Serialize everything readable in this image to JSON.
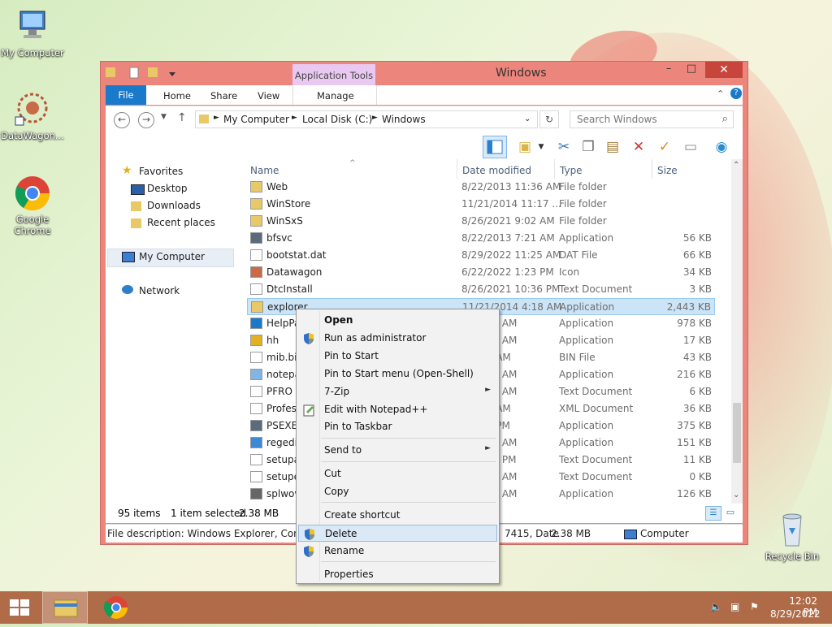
{
  "desktop": {
    "icons": [
      {
        "label": "My Computer"
      },
      {
        "label": "DataWagon..."
      },
      {
        "label": "Google Chrome"
      },
      {
        "label": "Recycle Bin"
      }
    ]
  },
  "window": {
    "title": "Windows",
    "ribbon_tabs": {
      "file": "File",
      "home": "Home",
      "share": "Share",
      "view": "View",
      "context_group": "Application Tools",
      "manage": "Manage"
    },
    "breadcrumb": [
      "My Computer",
      "Local Disk (C:)",
      "Windows"
    ],
    "search_placeholder": "Search Windows",
    "nav": {
      "favorites": "Favorites",
      "desktop": "Desktop",
      "downloads": "Downloads",
      "recent": "Recent places",
      "my_computer": "My Computer",
      "network": "Network"
    },
    "columns": {
      "name": "Name",
      "date": "Date modified",
      "type": "Type",
      "size": "Size"
    },
    "files": [
      {
        "name": "Web",
        "date": "8/22/2013 11:36 AM",
        "type": "File folder",
        "size": "",
        "icon": "folder-icon"
      },
      {
        "name": "WinStore",
        "date": "11/21/2014 11:17 ...",
        "type": "File folder",
        "size": "",
        "icon": "folder-icon"
      },
      {
        "name": "WinSxS",
        "date": "8/26/2021 9:02 AM",
        "type": "File folder",
        "size": "",
        "icon": "folder-icon"
      },
      {
        "name": "bfsvc",
        "date": "8/22/2013 7:21 AM",
        "type": "Application",
        "size": "56 KB",
        "icon": "app-icon"
      },
      {
        "name": "bootstat.dat",
        "date": "8/29/2022 11:25 AM",
        "type": "DAT File",
        "size": "66 KB",
        "icon": "file-icon"
      },
      {
        "name": "Datawagon",
        "date": "6/22/2022 1:23 PM",
        "type": "Icon",
        "size": "34 KB",
        "icon": "datawagon-icon"
      },
      {
        "name": "DtcInstall",
        "date": "8/26/2021 10:36 PM",
        "type": "Text Document",
        "size": "3 KB",
        "icon": "text-icon"
      },
      {
        "name": "explorer",
        "date": "11/21/2014 4:18 AM",
        "type": "Application",
        "size": "2,443 KB",
        "icon": "explorer-icon",
        "selected": true
      },
      {
        "name": "HelpPa",
        "date": "14 4:17 AM",
        "type": "Application",
        "size": "978 KB",
        "icon": "help-icon"
      },
      {
        "name": "hh",
        "date": "14 4:17 AM",
        "type": "Application",
        "size": "17 KB",
        "icon": "help-app-icon"
      },
      {
        "name": "mib.bi",
        "date": "3 3:01 AM",
        "type": "BIN File",
        "size": "43 KB",
        "icon": "file-icon"
      },
      {
        "name": "notepa",
        "date": "14 4:17 AM",
        "type": "Application",
        "size": "216 KB",
        "icon": "notepad-icon"
      },
      {
        "name": "PFRO",
        "date": "21 4:09 AM",
        "type": "Text Document",
        "size": "6 KB",
        "icon": "text-icon"
      },
      {
        "name": "Profess",
        "date": "3 2:51 AM",
        "type": "XML Document",
        "size": "36 KB",
        "icon": "xml-icon"
      },
      {
        "name": "PSEXES",
        "date": "2 2:34 PM",
        "type": "Application",
        "size": "375 KB",
        "icon": "app-icon"
      },
      {
        "name": "regedit",
        "date": "14 4:17 AM",
        "type": "Application",
        "size": "151 KB",
        "icon": "regedit-icon"
      },
      {
        "name": "setupa",
        "date": "1 10:35 PM",
        "type": "Text Document",
        "size": "11 KB",
        "icon": "text-icon"
      },
      {
        "name": "setupe",
        "date": "3 10:46 AM",
        "type": "Text Document",
        "size": "0 KB",
        "icon": "text-icon"
      },
      {
        "name": "splwov",
        "date": "14 4:17 AM",
        "type": "Application",
        "size": "126 KB",
        "icon": "printer-icon"
      }
    ],
    "status": {
      "count": "95 items",
      "selected": "1 item selected",
      "size": "2.38 MB"
    },
    "description": {
      "left": "File description: Windows Explorer, Compan",
      "mid": "7415, Date",
      "size": "2.38 MB",
      "location": "Computer"
    }
  },
  "context_menu": {
    "items": [
      {
        "label": "Open",
        "bold": true
      },
      {
        "label": "Run as administrator",
        "icon": "shield-icon"
      },
      {
        "label": "Pin to Start"
      },
      {
        "label": "Pin to Start menu (Open-Shell)"
      },
      {
        "label": "7-Zip",
        "submenu": true
      },
      {
        "label": "Edit with Notepad++",
        "icon": "notepad-plus-icon"
      },
      {
        "label": "Pin to Taskbar"
      },
      {
        "label": "Send to",
        "submenu": true
      },
      {
        "label": "Cut"
      },
      {
        "label": "Copy"
      },
      {
        "label": "Create shortcut"
      },
      {
        "label": "Delete",
        "icon": "shield-icon",
        "highlighted": true
      },
      {
        "label": "Rename",
        "icon": "shield-icon"
      },
      {
        "label": "Properties"
      }
    ]
  },
  "taskbar": {
    "time": "12:02 PM",
    "date": "8/29/2022"
  },
  "colors": {
    "window_frame": "#ec857c",
    "file_tab": "#1979ca",
    "selection": "#cce4f7",
    "taskbar": "#aa5f3c"
  }
}
